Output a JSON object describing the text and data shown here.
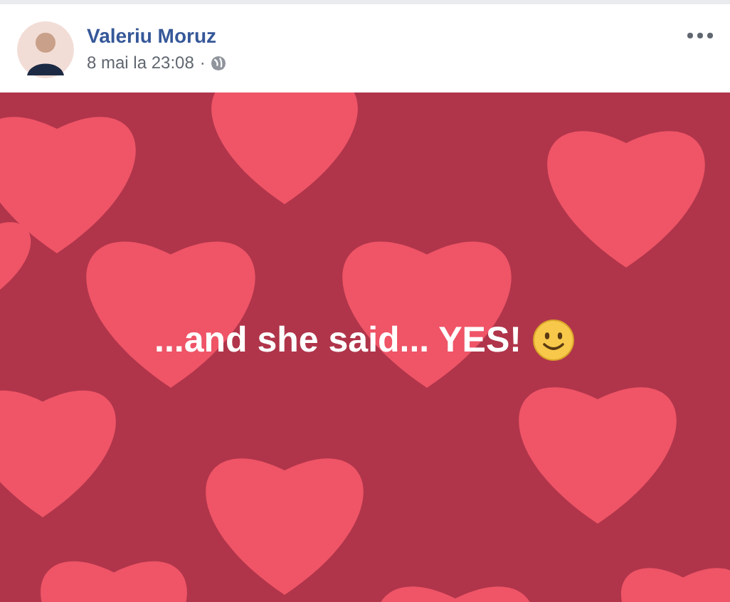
{
  "post": {
    "author": "Valeriu Moruz",
    "timestamp": "8 mai la 23:08",
    "separator": "·",
    "text": "...and she said... YES!"
  }
}
